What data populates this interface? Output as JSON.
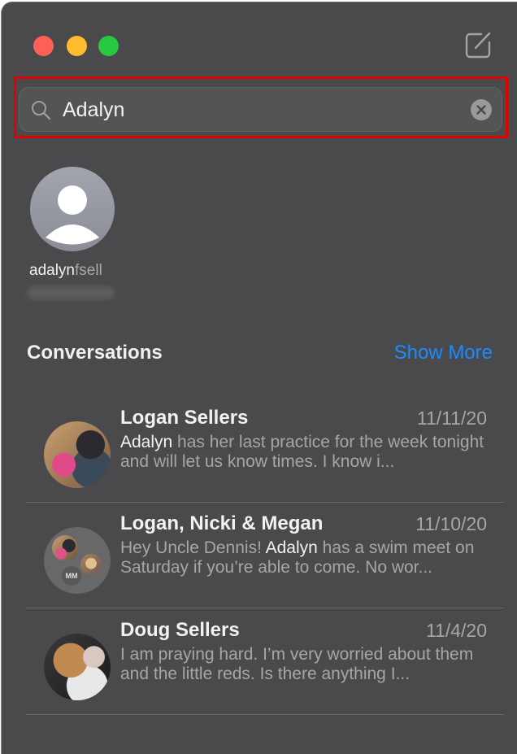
{
  "window": {
    "traffic_lights": [
      "close",
      "minimize",
      "maximize"
    ],
    "compose_icon": "compose-icon"
  },
  "search": {
    "value": "Adalyn",
    "icon": "search-icon",
    "clear_icon": "clear-icon"
  },
  "contact": {
    "username_match": "adalyn",
    "username_rest": "fsell",
    "subtitle": "",
    "avatar_icon": "person-placeholder-icon"
  },
  "conversations": {
    "title": "Conversations",
    "show_more": "Show More",
    "items": [
      {
        "name": "Logan Sellers",
        "date": "11/11/20",
        "preview_before": "",
        "preview_match": "Adalyn",
        "preview_after": " has her last practice for the week tonight and will let us know times. I know i..."
      },
      {
        "name": "Logan, Nicki & Megan",
        "date": "11/10/20",
        "preview_before": "Hey Uncle Dennis! ",
        "preview_match": "Adalyn",
        "preview_after": " has a swim meet on Saturday if you’re able to come. No wor...",
        "group_initials": "MM"
      },
      {
        "name": "Doug Sellers",
        "date": "11/4/20",
        "preview_before": "I am praying hard. I’m very worried about them and the little reds. Is there anything I...",
        "preview_match": "",
        "preview_after": ""
      }
    ]
  },
  "colors": {
    "background": "#4a4a4c",
    "accent": "#1a8cff",
    "highlight_border": "#e30000"
  }
}
